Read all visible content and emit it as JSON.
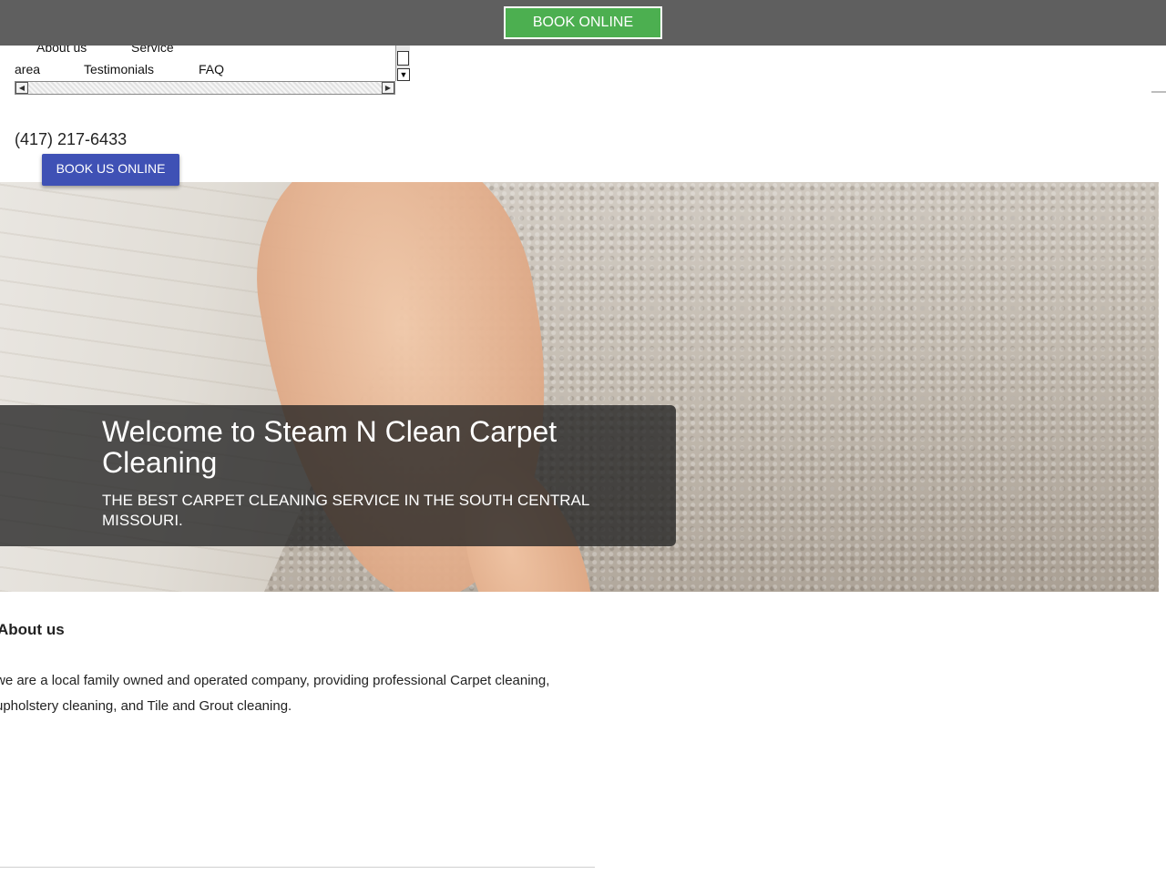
{
  "topbar": {
    "book_online_label": "BOOK ONLINE"
  },
  "nav": {
    "items": [
      {
        "label": "About us"
      },
      {
        "label": "Service"
      },
      {
        "label": "area"
      },
      {
        "label": "Testimonials"
      },
      {
        "label": "FAQ"
      }
    ]
  },
  "contact": {
    "phone": "(417) 217-6433",
    "book_us_label": "BOOK US ONLINE"
  },
  "hero": {
    "title": "Welcome to Steam N Clean Carpet Cleaning",
    "subtitle": "THE BEST CARPET CLEANING SERVICE IN THE SOUTH CENTRAL MISSOURI."
  },
  "about": {
    "heading": "About us",
    "text": "we are a local family owned and operated company, providing professional Carpet cleaning, upholstery cleaning, and Tile and Grout cleaning."
  },
  "colors": {
    "topbar": "#5f5f5f",
    "book_online_green": "#4caf50",
    "book_us_blue": "#3f51b5"
  }
}
